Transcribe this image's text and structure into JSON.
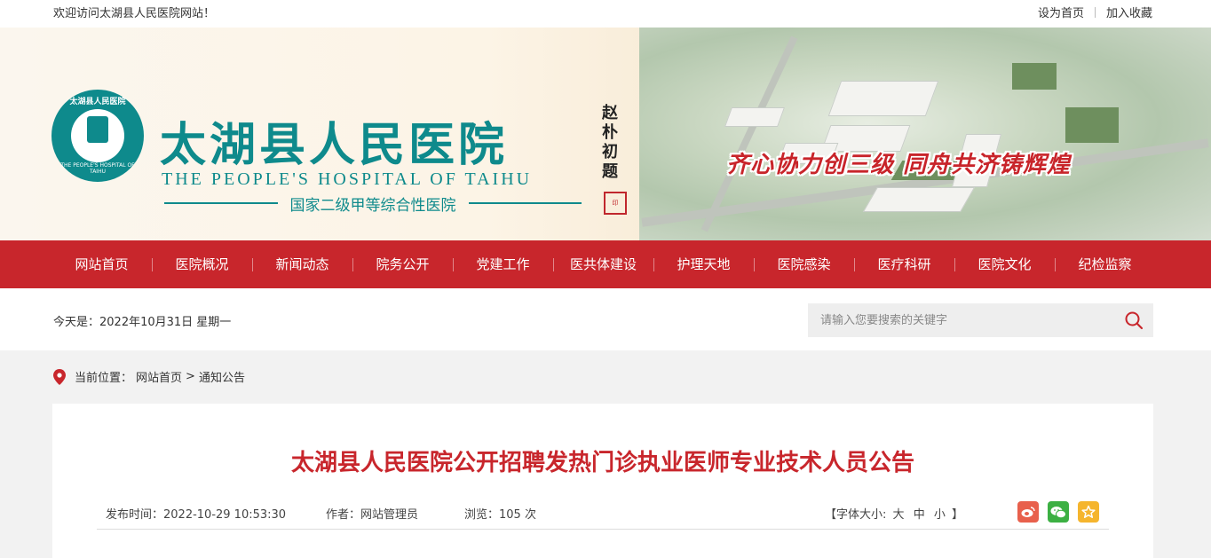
{
  "topbar": {
    "welcome": "欢迎访问太湖县人民医院网站！",
    "set_home": "设为首页",
    "add_favorite": "加入收藏"
  },
  "header": {
    "logo_ring_text": "太湖县人民医院",
    "logo_ring_en": "THE PEOPLE'S HOSPITAL OF TAIHU",
    "hospital_name_cn": "太湖县人民医院",
    "hospital_name_en": "THE PEOPLE'S HOSPITAL OF TAIHU",
    "hospital_level": "国家二级甲等综合性医院",
    "calligraphy": "赵朴初题",
    "slogan": "齐心协力创三级  同舟共济铸辉煌"
  },
  "nav": {
    "items": [
      "网站首页",
      "医院概况",
      "新闻动态",
      "院务公开",
      "党建工作",
      "医共体建设",
      "护理天地",
      "医院感染",
      "医疗科研",
      "医院文化",
      "纪检监察"
    ]
  },
  "infobar": {
    "date": "今天是：2022年10月31日 星期一",
    "search_placeholder": "请输入您要搜索的关键字"
  },
  "breadcrumb": {
    "label": "当前位置：",
    "home": "网站首页",
    "sep": ">",
    "current": "通知公告"
  },
  "article": {
    "title": "太湖县人民医院公开招聘发热门诊执业医师专业技术人员公告",
    "publish_time": "发布时间：2022-10-29 10:53:30",
    "author": "作者：网站管理员",
    "views": "浏览：105 次",
    "font_size_label": "【字体大小:",
    "font_large": "大",
    "font_medium": "中",
    "font_small": "小",
    "font_size_end": "】"
  },
  "colors": {
    "brand_red": "#c8262c",
    "brand_teal": "#0e8a8c",
    "weibo": "#e8604c",
    "wechat": "#3cb043",
    "favorite": "#f5b52e"
  }
}
